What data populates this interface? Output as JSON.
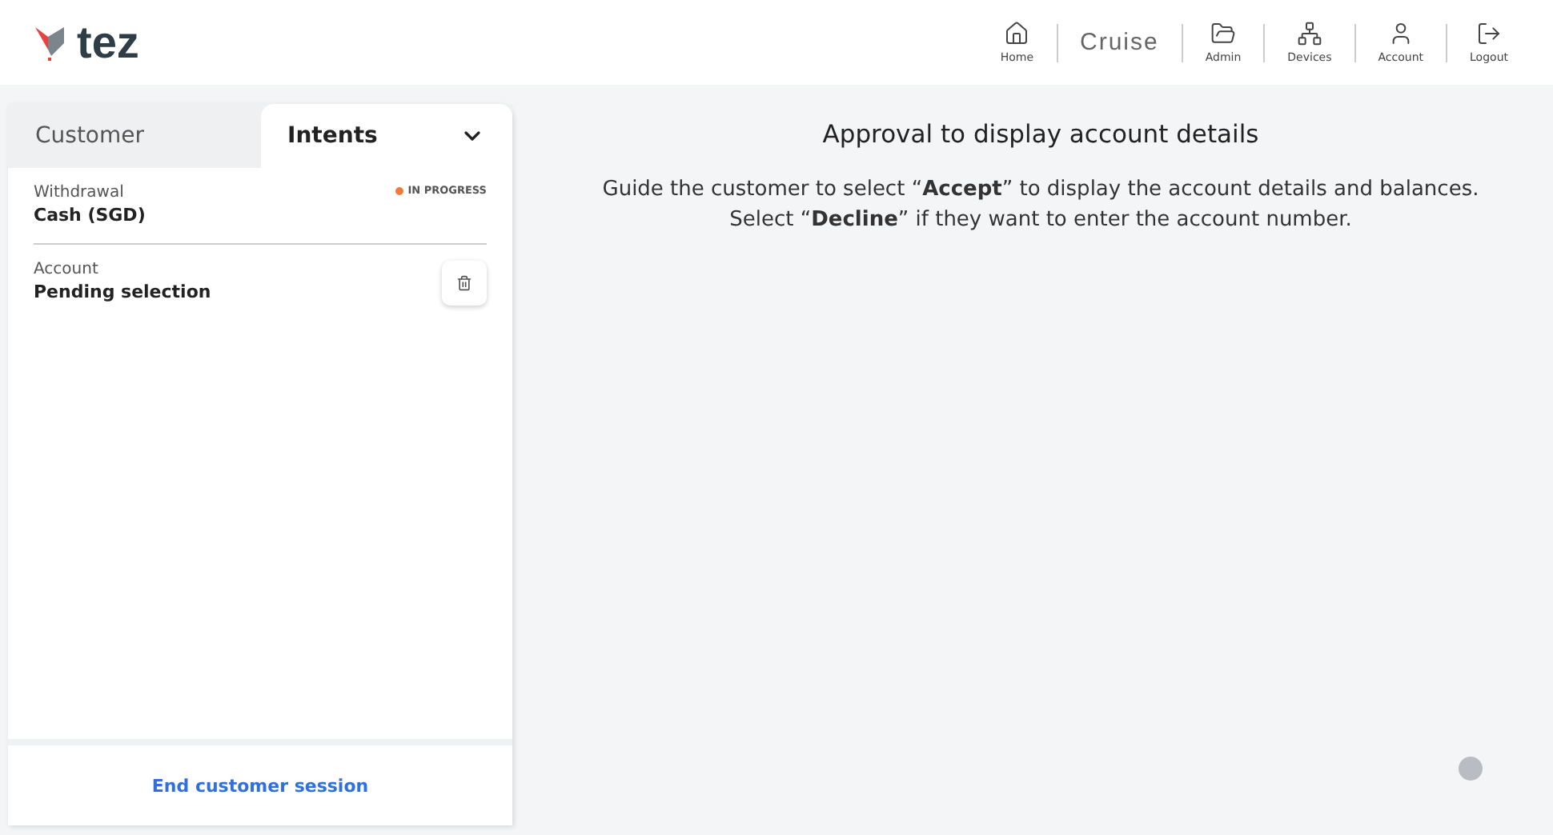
{
  "header": {
    "brand": "tez",
    "nav": [
      {
        "kind": "link",
        "label": "Home"
      },
      {
        "kind": "logo",
        "label": "Cruise"
      },
      {
        "kind": "link",
        "label": "Admin"
      },
      {
        "kind": "link",
        "label": "Devices"
      },
      {
        "kind": "link",
        "label": "Account"
      },
      {
        "kind": "link",
        "label": "Logout"
      }
    ]
  },
  "panel": {
    "tabs": [
      {
        "label": "Customer",
        "selected": false
      },
      {
        "label": "Intents",
        "selected": true
      }
    ],
    "intents": [
      {
        "label": "Withdrawal",
        "value": "Cash (SGD)",
        "status": {
          "text": "IN PROGRESS",
          "color": "#f07a3a"
        }
      },
      {
        "label": "Account",
        "value": "Pending selection",
        "deletable": true
      }
    ],
    "end_session": "End customer session"
  },
  "main": {
    "title": "Approval to display account details",
    "lines": [
      "Guide the customer to select “**Accept**” to display the account details and balances.",
      "Select “**Decline**” if they want to enter the account number."
    ]
  }
}
